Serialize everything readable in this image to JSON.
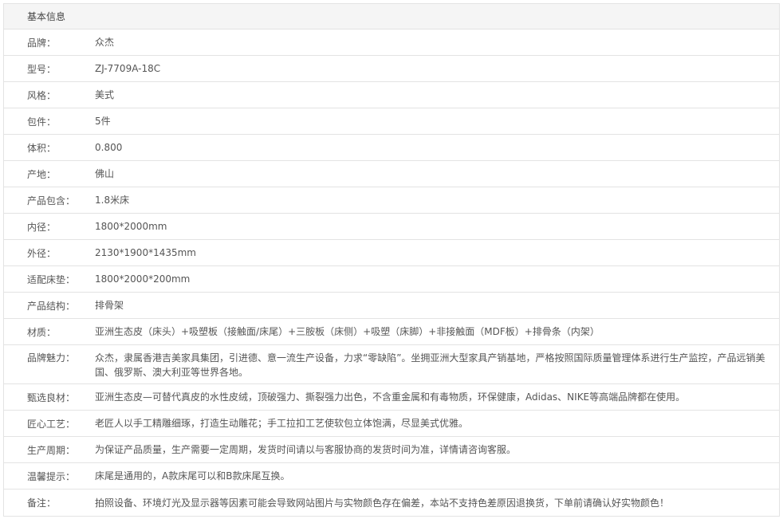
{
  "section": {
    "title": "基本信息"
  },
  "rows": [
    {
      "label": "品牌：",
      "value": "众杰"
    },
    {
      "label": "型号：",
      "value": "ZJ-7709A-18C"
    },
    {
      "label": "风格：",
      "value": "美式"
    },
    {
      "label": "包件：",
      "value": "5件"
    },
    {
      "label": "体积：",
      "value": "0.800"
    },
    {
      "label": "产地：",
      "value": "佛山"
    },
    {
      "label": "产品包含：",
      "value": "1.8米床"
    },
    {
      "label": "内径：",
      "value": "1800*2000mm"
    },
    {
      "label": "外径：",
      "value": "2130*1900*1435mm"
    },
    {
      "label": "适配床垫：",
      "value": "1800*2000*200mm"
    },
    {
      "label": "产品结构：",
      "value": "排骨架"
    },
    {
      "label": "材质：",
      "value": "亚洲生态皮（床头）+吸塑板（接触面/床尾）+三胺板（床侧）+吸塑（床脚）+非接触面（MDF板）+排骨条（内架）"
    },
    {
      "label": "品牌魅力：",
      "value": "众杰，隶属香港吉美家具集团，引进德、意一流生产设备，力求“零缺陷”。坐拥亚洲大型家具产销基地，严格按照国际质量管理体系进行生产监控，产品远销美国、俄罗斯、澳大利亚等世界各地。"
    },
    {
      "label": "甄选良材：",
      "value": "亚洲生态皮—可替代真皮的水性皮绒，顶破强力、撕裂强力出色，不含重金属和有毒物质，环保健康，Adidas、NIKE等高端品牌都在使用。"
    },
    {
      "label": "匠心工艺：",
      "value": "老匠人以手工精雕细琢，打造生动雕花；手工拉扣工艺使软包立体饱满，尽显美式优雅。"
    },
    {
      "label": "生产周期：",
      "value": "为保证产品质量，生产需要一定周期，发货时间请以与客服协商的发货时间为准，详情请咨询客服。"
    },
    {
      "label": "温馨提示：",
      "value": "床尾是通用的，A款床尾可以和B款床尾互换。"
    },
    {
      "label": "备注：",
      "value": "拍照设备、环境灯光及显示器等因素可能会导致网站图片与实物颜色存在偏差，本站不支持色差原因退换货，下单前请确认好实物颜色！"
    }
  ]
}
